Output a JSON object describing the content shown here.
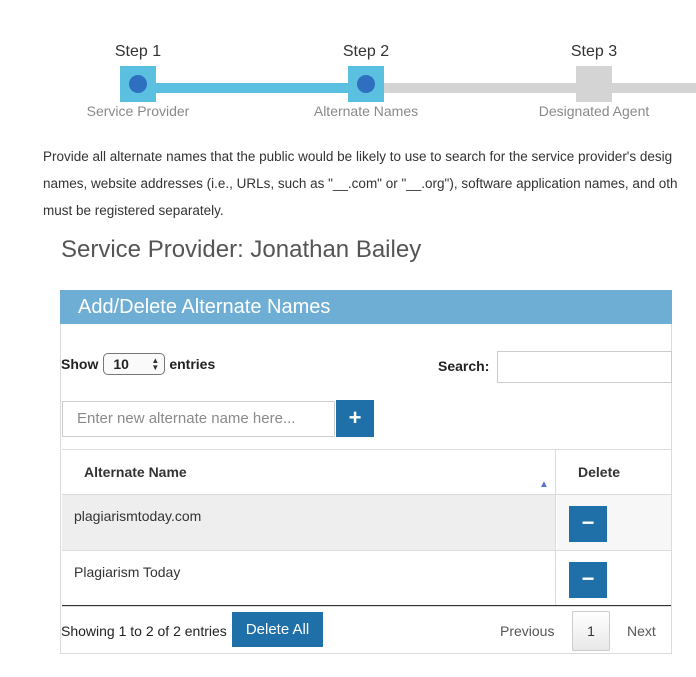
{
  "stepper": {
    "steps": [
      {
        "label": "Step 1",
        "caption": "Service Provider",
        "state": "active"
      },
      {
        "label": "Step 2",
        "caption": "Alternate Names",
        "state": "active"
      },
      {
        "label": "Step 3",
        "caption": "Designated Agent",
        "state": "inactive"
      }
    ],
    "colors": {
      "active": "#5bbfe0",
      "inactive": "#d4d4d4",
      "dot": "#2e6fbf"
    }
  },
  "intro": {
    "lines": [
      "Provide all alternate names that the public would be likely to use to search for the service provider's desig",
      "names, website addresses (i.e., URLs, such as \"__.com\" or \"__.org\"), software application names, and oth",
      "must be registered separately."
    ]
  },
  "provider_title": "Service Provider: Jonathan Bailey",
  "panel": {
    "header": "Add/Delete Alternate Names",
    "show_label": "Show",
    "entries_value": "10",
    "entries_label": "entries",
    "search_label": "Search:",
    "search_value": "",
    "new_name_placeholder": "Enter new alternate name here...",
    "add_button_icon": "plus-icon",
    "add_button_glyph": "+",
    "table": {
      "headers": {
        "name": "Alternate Name",
        "delete": "Delete"
      },
      "sort_icon": "sort-ascending-icon",
      "rows": [
        {
          "name": "plagiarismtoday.com"
        },
        {
          "name": "Plagiarism Today"
        }
      ],
      "delete_button_icon": "minus-icon",
      "delete_button_glyph": "−"
    },
    "footer": {
      "info": "Showing 1 to 2 of 2 entries",
      "delete_all": "Delete All",
      "previous": "Previous",
      "current_page": "1",
      "next": "Next"
    }
  },
  "colors": {
    "panel_header": "#6eaed4",
    "button": "#1f6fa8"
  }
}
